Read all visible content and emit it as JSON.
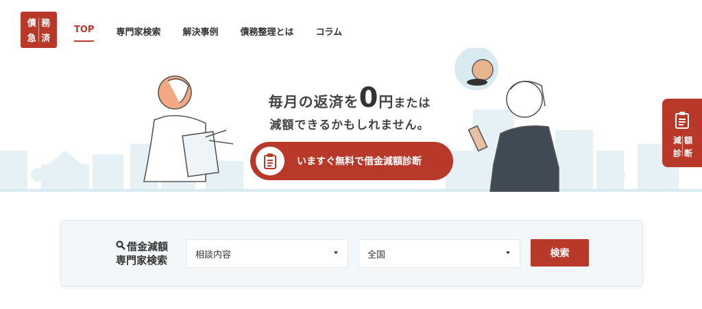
{
  "brand": {
    "logo_chars": [
      "債",
      "務",
      "急",
      "済"
    ],
    "accent": "#b8382a"
  },
  "nav": {
    "items": [
      {
        "label": "TOP",
        "active": true
      },
      {
        "label": "専門家検索",
        "active": false
      },
      {
        "label": "解決事例",
        "active": false
      },
      {
        "label": "債務整理とは",
        "active": false
      },
      {
        "label": "コラム",
        "active": false
      }
    ]
  },
  "hero": {
    "line1_a": "毎月の返済を",
    "line1_big": "0",
    "line1_b": "円",
    "line1_c": "または",
    "line2": "減額できるかもしれません。",
    "cta_label": "いますぐ無料で借金減額診断",
    "coin_symbol": "¥"
  },
  "side_tab": {
    "chars": [
      "減",
      "額",
      "診",
      "断"
    ],
    "icon": "clipboard-icon"
  },
  "search": {
    "label_line1": "借金減額",
    "label_line2": "専門家検索",
    "select1_value": "相談内容",
    "select2_value": "全国",
    "button_label": "検索"
  }
}
